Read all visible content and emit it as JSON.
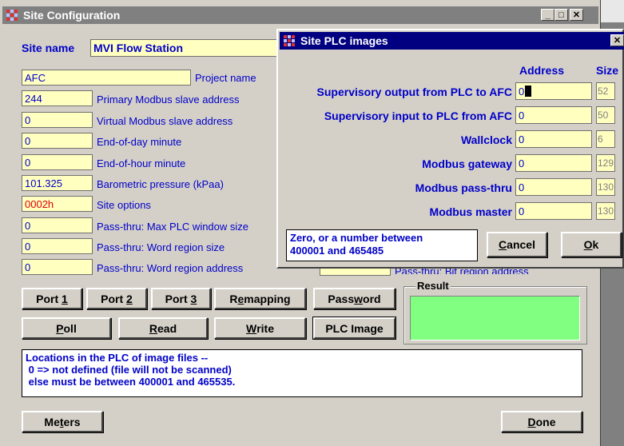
{
  "main_window": {
    "title": "Site Configuration",
    "site_name_label": "Site name",
    "site_name_value": "MVI Flow Station",
    "fields": [
      {
        "value": "AFC",
        "label": "Project name"
      },
      {
        "value": "244",
        "label": "Primary Modbus slave address"
      },
      {
        "value": "0",
        "label": "Virtual Modbus slave address"
      },
      {
        "value": "0",
        "label": "End-of-day minute"
      },
      {
        "value": "0",
        "label": "End-of-hour minute"
      },
      {
        "value": "101.325",
        "label": "Barometric pressure (kPaa)"
      },
      {
        "value": "0002h",
        "label": "Site options"
      },
      {
        "value": "0",
        "label": "Pass-thru: Max PLC window size"
      },
      {
        "value": "0",
        "label": "Pass-thru: Word region size"
      },
      {
        "value": "0",
        "label": "Pass-thru: Word region address"
      }
    ],
    "partial_label": "Pass-thru: Bit region address",
    "buttons": {
      "port1_pre": "Port ",
      "port1_key": "1",
      "port2_pre": "Port ",
      "port2_key": "2",
      "port3_pre": "Port ",
      "port3_key": "3",
      "remap_pre": "R",
      "remap_key": "e",
      "remap_post": "mapping",
      "pw_pre": "Pass",
      "pw_key": "w",
      "pw_post": "ord",
      "poll_key": "P",
      "poll_post": "oll",
      "read_key": "R",
      "read_post": "ead",
      "write_key": "W",
      "write_post": "rite",
      "plc_pre": "PLC Ima",
      "plc_key": "g",
      "plc_post": "e",
      "meters_pre": "Me",
      "meters_key": "t",
      "meters_post": "ers",
      "done_key": "D",
      "done_post": "one"
    },
    "result_label": "Result",
    "result_color": "#80ff80",
    "info_lines": [
      "Locations in the PLC of image files --",
      " 0 => not defined (file will not be scanned)",
      " else must be between 400001 and 465535."
    ],
    "controls": {
      "minimize": "_",
      "maximize": "□",
      "close": "✕"
    }
  },
  "dialog": {
    "title": "Site PLC images",
    "close": "✕",
    "header_address": "Address",
    "header_size": "Size",
    "rows": [
      {
        "label": "Supervisory output from PLC to AFC",
        "address": "0",
        "size": "52"
      },
      {
        "label": "Supervisory input to PLC from AFC",
        "address": "0",
        "size": "50"
      },
      {
        "label": "Wallclock",
        "address": "0",
        "size": "6"
      },
      {
        "label": "Modbus gateway",
        "address": "0",
        "size": "129"
      },
      {
        "label": "Modbus pass-thru",
        "address": "0",
        "size": "130"
      },
      {
        "label": "Modbus master",
        "address": "0",
        "size": "130"
      }
    ],
    "hint_lines": [
      "Zero, or a number between",
      "400001 and 465485"
    ],
    "cancel_key": "C",
    "cancel_post": "ancel",
    "ok_key": "O",
    "ok_post": "k"
  },
  "colors": {
    "label_blue": "#0000c8",
    "field_yellow": "#ffffc0",
    "title_active": "#000080",
    "title_inactive": "#808080"
  }
}
